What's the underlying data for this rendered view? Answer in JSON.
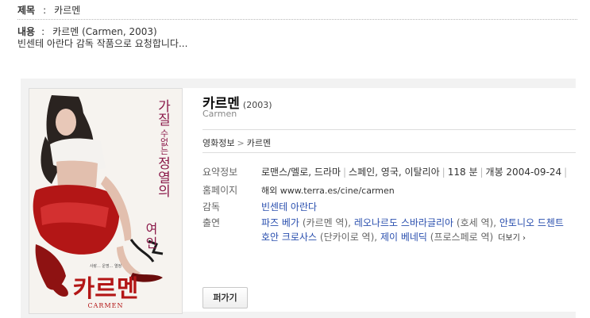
{
  "post": {
    "title_label": "제목",
    "separator": ":",
    "title_value": "카르멘",
    "content_label": "내용",
    "content_value": "카르멘 (Carmen, 2003)",
    "content_body": "빈센테 아란다 감독 작품으로 요청합니다..."
  },
  "movie": {
    "title_ko": "카르멘",
    "year": "(2003)",
    "title_en": "Carmen",
    "breadcrumb": {
      "root": "영화정보",
      "arrow": ">",
      "current": "카르멘"
    },
    "poster": {
      "tagline": "가질 수 없는 정열의 여인",
      "title": "카르멘",
      "title_en": "CARMEN",
      "small_caption": "사랑... 운명... 열정"
    },
    "summary": {
      "label": "요약정보",
      "genre": "로맨스/멜로, 드라마",
      "countries": "스페인, 영국, 이탈리아",
      "runtime": "118 분",
      "release": "개봉 2004-09-24",
      "pipe": "|"
    },
    "homepage": {
      "label": "홈페이지",
      "prefix": "해외",
      "url": "www.terra.es/cine/carmen"
    },
    "director": {
      "label": "감독",
      "name": "빈센테 아란다"
    },
    "cast": {
      "label": "출연",
      "members": [
        {
          "name": "파즈 베가",
          "role": "(카르멘 역)"
        },
        {
          "name": "레오나르도 스바라글리아",
          "role": "(호세 역)"
        },
        {
          "name": "안토니오 드첸트",
          "role": ""
        },
        {
          "name": "호안 크로사스",
          "role": "(단카이로 역)"
        },
        {
          "name": "제이 베네딕",
          "role": "(프로스페로 역)"
        }
      ],
      "sep": ",",
      "more": "더보기 ›"
    },
    "share_button": "퍼가기"
  }
}
